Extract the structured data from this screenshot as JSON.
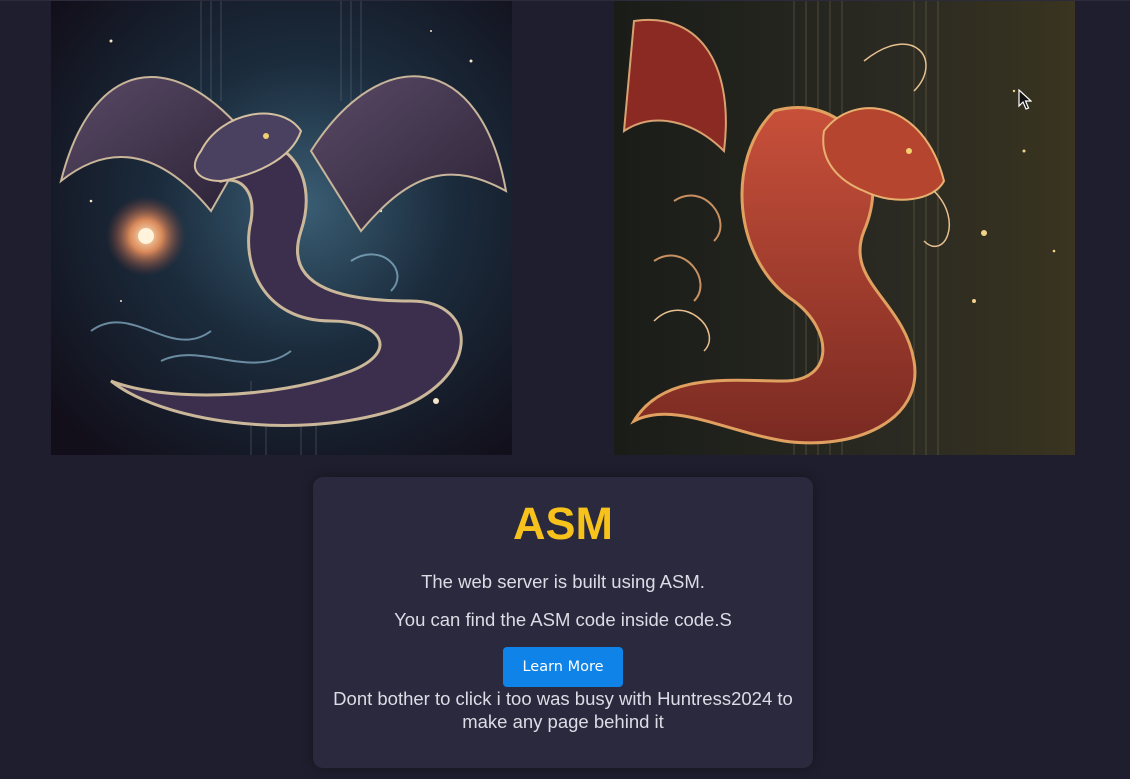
{
  "images": {
    "left": {
      "icon": "dragon-purple-illustration"
    },
    "right": {
      "icon": "dragon-red-illustration"
    }
  },
  "card": {
    "title": "ASM",
    "line1": "The web server is built using ASM.",
    "line2": "You can find the ASM code inside code.S",
    "button_label": "Learn More",
    "note": "Dont bother to click i too was busy with Huntress2024 to make any page behind it"
  },
  "colors": {
    "background": "#1f1e2e",
    "card": "#2a293d",
    "title": "#f7c21b",
    "button": "#0f83e8"
  }
}
